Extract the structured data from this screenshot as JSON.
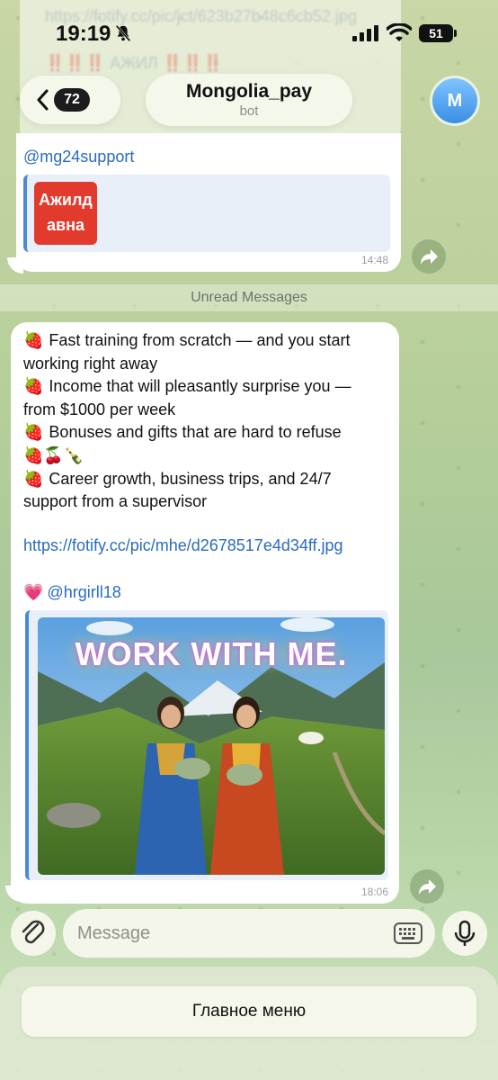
{
  "status_bar": {
    "time": "19:19",
    "battery": "51"
  },
  "ghost": {
    "line1": "https://fotify.cc/pic/jct/623b27b48c6cb52.jpg",
    "line2": "‼️‼️‼️ АЖИЛ ‼️‼️‼️"
  },
  "header": {
    "unread_count": "72",
    "title": "Mongolia_pay",
    "subtitle": "bot",
    "avatar_letter": "M"
  },
  "message1": {
    "mention": "@mg24support",
    "preview_text_line1": "Ажилд",
    "preview_text_line2": "авна",
    "time": "14:48"
  },
  "unread_divider": "Unread Messages",
  "message2": {
    "lines": [
      {
        "emoji": "🍓",
        "text": "Fast training from scratch — and you start"
      },
      {
        "emoji": "",
        "text": "working right away"
      },
      {
        "emoji": "🍓",
        "text": "Income that will pleasantly surprise you —"
      },
      {
        "emoji": "",
        "text": "from $1000 per week"
      },
      {
        "emoji": "🍓",
        "text": "Bonuses and gifts that are hard to refuse"
      },
      {
        "emoji": "🍓🍒🍾",
        "text": ""
      },
      {
        "emoji": "🍓",
        "text": "Career growth, business trips, and 24/7"
      },
      {
        "emoji": "",
        "text": "support from a supervisor"
      }
    ],
    "link": "https://fotify.cc/pic/mhe/d2678517e4d34ff.jpg",
    "heart": "💗",
    "mention": "@hrgirll18",
    "image_title": "WORK WITH ME.",
    "time": "18:06"
  },
  "input": {
    "placeholder": "Message"
  },
  "menu": {
    "button_label": "Главное меню"
  },
  "colors": {
    "link": "#2a6bbf",
    "quote_bar": "#4a8ad4",
    "thumb_red": "#e23b2e"
  }
}
